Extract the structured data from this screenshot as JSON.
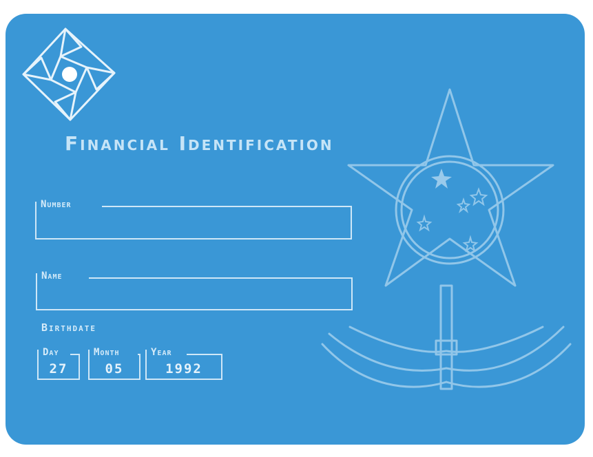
{
  "card": {
    "title": "Financial Identification",
    "background_color": "#3a97d6",
    "accent_color": "#cfe7f7"
  },
  "fields": {
    "number": {
      "label": "Number",
      "value": ""
    },
    "name": {
      "label": "Name",
      "value": ""
    }
  },
  "birthdate": {
    "label": "Birthdate",
    "day": {
      "label": "Day",
      "value": "27"
    },
    "month": {
      "label": "Month",
      "value": "05"
    },
    "year": {
      "label": "Year",
      "value": "1992"
    }
  },
  "icons": {
    "logo": "spiral-diamond-logo-icon",
    "emblem": "star-emblem-icon"
  }
}
